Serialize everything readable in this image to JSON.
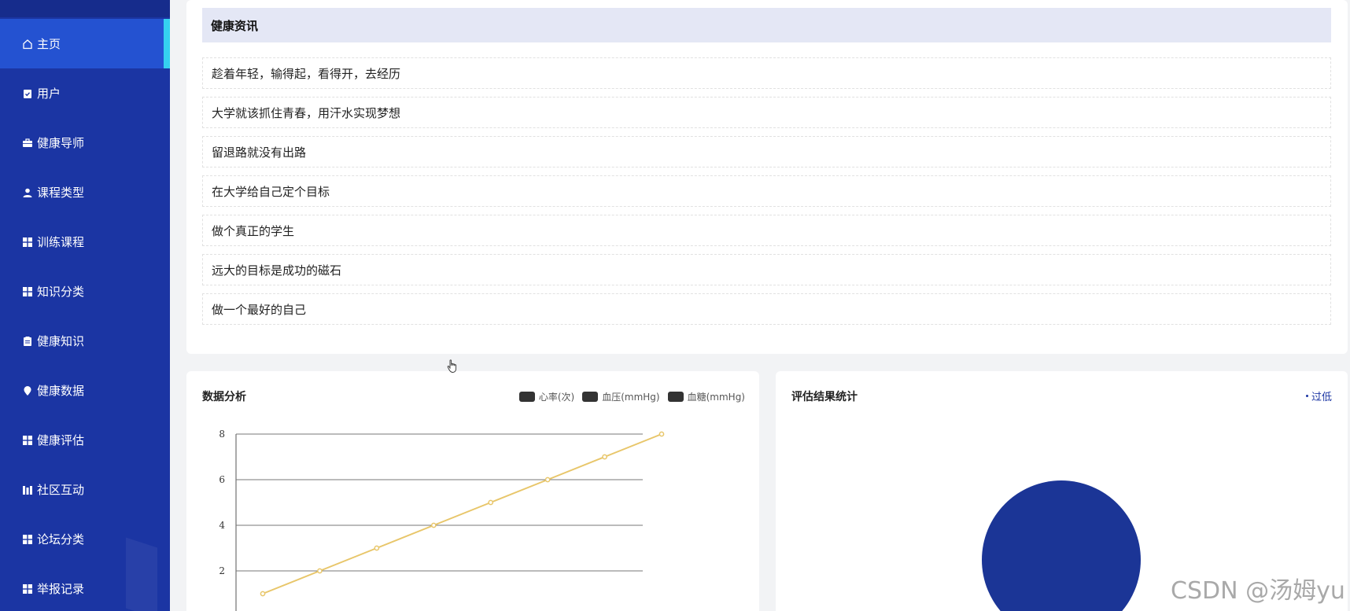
{
  "sidebar": {
    "items": [
      {
        "label": "主页",
        "icon": "home-icon",
        "active": true
      },
      {
        "label": "用户",
        "icon": "clipboard-check-icon"
      },
      {
        "label": "健康导师",
        "icon": "briefcase-icon"
      },
      {
        "label": "课程类型",
        "icon": "user-icon"
      },
      {
        "label": "训练课程",
        "icon": "grid-icon"
      },
      {
        "label": "知识分类",
        "icon": "grid-icon"
      },
      {
        "label": "健康知识",
        "icon": "clipboard-icon"
      },
      {
        "label": "健康数据",
        "icon": "map-pin-icon"
      },
      {
        "label": "健康评估",
        "icon": "grid-icon"
      },
      {
        "label": "社区互动",
        "icon": "bar-chart-icon"
      },
      {
        "label": "论坛分类",
        "icon": "grid-icon"
      },
      {
        "label": "举报记录",
        "icon": "grid-icon"
      }
    ]
  },
  "news": {
    "title": "健康资讯",
    "items": [
      "趁着年轻，输得起，看得开，去经历",
      "大学就该抓住青春，用汗水实现梦想",
      "留退路就没有出路",
      "在大学给自己定个目标",
      "做个真正的学生",
      "远大的目标是成功的磁石",
      "做一个最好的自己"
    ]
  },
  "analysis": {
    "title": "数据分析",
    "legend": [
      "心率(次)",
      "血压(mmHg)",
      "血糖(mmHg)"
    ]
  },
  "evaluation": {
    "title": "评估结果统计",
    "legend_label": "过低"
  },
  "watermark": "CSDN @汤姆yu",
  "colors": {
    "sidebar_bg": "#1b35a3",
    "sidebar_active": "#2452d1",
    "active_indicator": "#35d1f0",
    "line_series": "#e8c66a",
    "pie_fill": "#1b3596",
    "news_header_bg": "#e4e7f5"
  },
  "chart_data": [
    {
      "type": "line",
      "title": "数据分析",
      "legend": [
        "心率(次)",
        "血压(mmHg)",
        "血糖(mmHg)"
      ],
      "legend_position": "top-right",
      "y_ticks": [
        2,
        4,
        6,
        8
      ],
      "ylim": [
        0,
        8
      ],
      "grid": true,
      "series": [
        {
          "values": [
            1,
            2,
            3,
            4,
            5,
            6,
            7,
            8
          ],
          "color": "#e8c66a"
        }
      ]
    },
    {
      "type": "pie",
      "title": "评估结果统计",
      "legend_position": "top-right",
      "slices": [
        {
          "label": "过低",
          "value": 1,
          "color": "#1b3596"
        }
      ]
    }
  ]
}
